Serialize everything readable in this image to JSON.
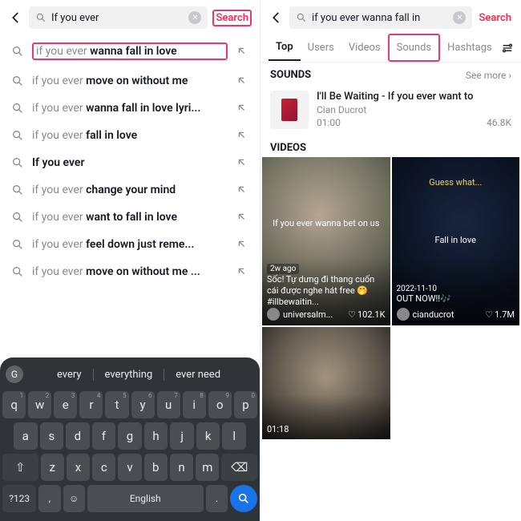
{
  "left": {
    "search_input": "If you ever",
    "search_button": "Search",
    "suggestions": [
      {
        "prefix": "if you ever ",
        "bold": "wanna fall in love",
        "highlighted": true
      },
      {
        "prefix": "if you ever ",
        "bold": "move on without me"
      },
      {
        "prefix": "if you ever ",
        "bold": "wanna fall in love lyri..."
      },
      {
        "prefix": "if you ever ",
        "bold": "fall in love"
      },
      {
        "prefix": "",
        "bold": "If you ever"
      },
      {
        "prefix": "if you ever ",
        "bold": "change your mind"
      },
      {
        "prefix": "if you ever ",
        "bold": "want to fall in love"
      },
      {
        "prefix": "if you ever ",
        "bold": "feel down just reme..."
      },
      {
        "prefix": "if you ever ",
        "bold": "move on without me ..."
      }
    ],
    "keyboard": {
      "word_suggestions": [
        "every",
        "everything",
        "ever need"
      ],
      "row1": [
        "q",
        "w",
        "e",
        "r",
        "t",
        "y",
        "u",
        "i",
        "o",
        "p"
      ],
      "row1_nums": [
        "1",
        "2",
        "3",
        "4",
        "5",
        "6",
        "7",
        "8",
        "9",
        "0"
      ],
      "row2": [
        "a",
        "s",
        "d",
        "f",
        "g",
        "h",
        "j",
        "k",
        "l"
      ],
      "row3": [
        "z",
        "x",
        "c",
        "v",
        "b",
        "n",
        "m"
      ],
      "shift": "⇧",
      "backspace": "⌫",
      "numkey": "?123",
      "comma": ",",
      "lang": "English",
      "period": "."
    }
  },
  "right": {
    "search_input": "if you ever wanna fall in",
    "search_button": "Search",
    "tabs": [
      "Top",
      "Users",
      "Videos",
      "Sounds",
      "Hashtags"
    ],
    "active_tab": "Top",
    "highlighted_tab": "Sounds",
    "sounds_header": "SOUNDS",
    "see_more": "See more",
    "sound": {
      "title": "I'll Be Waiting - If you ever want to",
      "artist": "Cian Ducrot",
      "duration": "01:00",
      "plays": "46.8K"
    },
    "videos_header": "VIDEOS",
    "videos": [
      {
        "ago": "2w ago",
        "overlay_line": "If you ever wanna bet on us",
        "caption": "Sốc! Tự dưng đi thang cuốn cái được nghe hát free 🤭 #illbewaitin...",
        "user": "universalm...",
        "likes": "102.1K"
      },
      {
        "center_top": "Guess what...",
        "center_mid": "Fall in love",
        "date": "2022-11-10",
        "caption": "OUT NOW!!🎶",
        "user": "cianducrot",
        "likes": "1.7M"
      },
      {
        "timestamp": "01:18"
      }
    ]
  }
}
